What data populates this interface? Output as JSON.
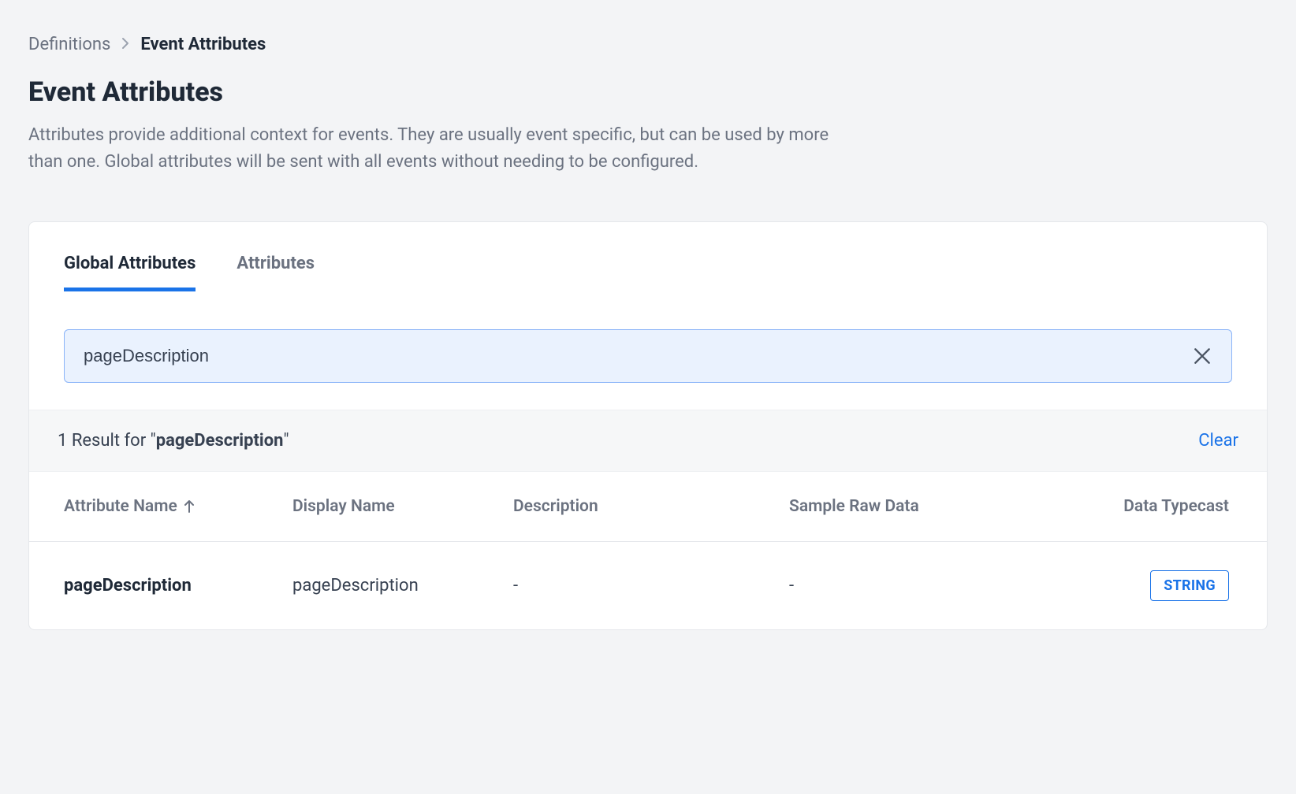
{
  "breadcrumb": {
    "parent": "Definitions",
    "current": "Event Attributes"
  },
  "header": {
    "title": "Event Attributes",
    "description": "Attributes provide additional context for events. They are usually event specific, but can be used by more than one. Global attributes will be sent with all events without needing to be configured."
  },
  "tabs": {
    "global": "Global Attributes",
    "attributes": "Attributes",
    "active": "global"
  },
  "search": {
    "value": "pageDescription"
  },
  "results": {
    "count_prefix": "1 Result for \"",
    "term": "pageDescription",
    "count_suffix": "\"",
    "clear": "Clear"
  },
  "table": {
    "headers": {
      "name": "Attribute Name",
      "display": "Display Name",
      "desc": "Description",
      "sample": "Sample Raw Data",
      "typecast": "Data Typecast"
    },
    "rows": [
      {
        "name": "pageDescription",
        "display": "pageDescription",
        "desc": "-",
        "sample": "-",
        "typecast": "STRING"
      }
    ]
  }
}
